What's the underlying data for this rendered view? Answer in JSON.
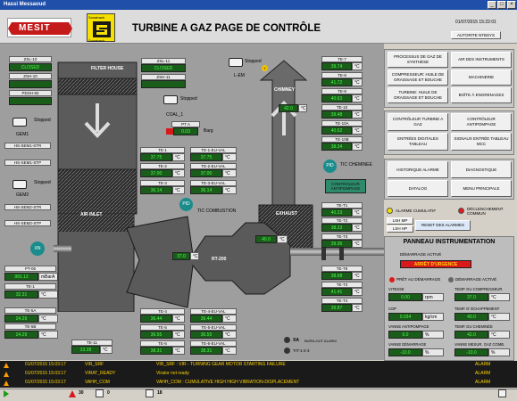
{
  "window": {
    "title": "Hassi Messaoud"
  },
  "header": {
    "logo": "MESIT",
    "brand_top": "Sonatrach",
    "brand_bottom": "Sonatrach",
    "title": "TURBINE A GAZ PAGE DE CONTRÔLE",
    "datetime": "01/07/2015 15:22:01",
    "authority": "AUTORITE NTBSYS"
  },
  "left": [
    {
      "label": "ZSL-10",
      "value": "CLOSED"
    },
    {
      "label": "ZSH-10",
      "value": ""
    },
    {
      "label": "PDSH-82",
      "value": ""
    }
  ],
  "motors_left": [
    {
      "label": "Stopped",
      "name": "GEM1"
    },
    {
      "label": "Stopped",
      "name": "GEM2"
    }
  ],
  "hs_labels": [
    "HS-SEM1-STR",
    "HS-SEM1-STP",
    "HS-SEM2-STR",
    "HS-SEM2-STP"
  ],
  "xn": "XN",
  "pt05": {
    "label": "PT-05",
    "value": "991.12",
    "unit": "mBarA"
  },
  "te1": {
    "label": "TE-1",
    "value": "32.31",
    "unit": "°C"
  },
  "te5a": {
    "label": "TE-5A",
    "value": "24.29",
    "unit": "°C"
  },
  "te5b": {
    "label": "TE-5B",
    "value": "24.29",
    "unit": "°C"
  },
  "filter_house": "FILTER HOUSE",
  "air_inlet": "AIR INLET",
  "zsl11": {
    "label": "ZSL-11",
    "value": "CLOSED"
  },
  "zsh11": {
    "label": "ZSH-11",
    "value": ""
  },
  "coal": {
    "state": "Stopped",
    "name": "COAL_1"
  },
  "lem": {
    "state": "Stopped",
    "name": "L-EM"
  },
  "pt_a": {
    "label": "PT A",
    "value": "0.03",
    "unit": "Barg"
  },
  "te_block1": [
    {
      "label": "TE-1",
      "value": "37.75",
      "unit": "°C"
    },
    {
      "label": "TE-2",
      "value": "37.00",
      "unit": "°C"
    },
    {
      "label": "TE-3",
      "value": "36.14",
      "unit": "°C"
    }
  ],
  "te_block1_val": [
    {
      "label": "TE-1-EU-VAL",
      "value": "37.75",
      "unit": "°C"
    },
    {
      "label": "TE-2-EU-VAL",
      "value": "37.00",
      "unit": "°C"
    },
    {
      "label": "TE-3-EU-VAL",
      "value": "36.14",
      "unit": "°C"
    }
  ],
  "combustion": {
    "pid": "PID",
    "label": "TIC COMBUSTION"
  },
  "rt200": "RT-200",
  "inner_val1": {
    "value": "37.0",
    "unit": "°C"
  },
  "inner_val2": {
    "value": "40.0",
    "unit": "°C"
  },
  "chimney": "CHIMNEY",
  "chimney_val": {
    "value": "42.0",
    "unit": "°C"
  },
  "exhaust": "EXHAUST",
  "te_block2": [
    {
      "label": "TE-4",
      "value": "36.44",
      "unit": "°C"
    },
    {
      "label": "TE-5",
      "value": "36.55",
      "unit": "°C"
    },
    {
      "label": "TE-6",
      "value": "38.31",
      "unit": "°C"
    }
  ],
  "te_block2_val": [
    {
      "label": "TE-4-EU-VAL",
      "value": "36.44",
      "unit": "°C"
    },
    {
      "label": "TE-5-EU-VAL",
      "value": "36.55",
      "unit": "°C"
    },
    {
      "label": "TE-6-EU-VAL",
      "value": "38.31",
      "unit": "°C"
    }
  ],
  "te11": {
    "label": "TE-11",
    "value": "23.28",
    "unit": "°C"
  },
  "chimney_tes": [
    {
      "label": "TE-7",
      "value": "39.74",
      "unit": "°C"
    },
    {
      "label": "TE-8",
      "value": "41.72",
      "unit": "°C"
    },
    {
      "label": "TE-9",
      "value": "40.63",
      "unit": "°C"
    },
    {
      "label": "TE-10",
      "value": "39.48",
      "unit": "°C"
    },
    {
      "label": "TE-10A",
      "value": "40.62",
      "unit": "°C"
    },
    {
      "label": "TE-10B",
      "value": "38.34",
      "unit": "°C"
    }
  ],
  "tic_cheminee": {
    "pid": "PID",
    "label": "TIC CHEMINEE"
  },
  "controleur": "CONTROLEUR ANTIPOMPAGE",
  "exhaust_tes": [
    {
      "label": "TE-T1",
      "value": "40.23",
      "unit": "°C"
    },
    {
      "label": "TE-T2",
      "value": "38.23",
      "unit": "°C"
    },
    {
      "label": "TE-T3",
      "value": "39.36",
      "unit": "°C"
    },
    {
      "label": "TE-T9",
      "value": "38.68",
      "unit": "°C"
    },
    {
      "label": "TE-T3",
      "value": "41.41",
      "unit": "°C"
    },
    {
      "label": "TE-T4",
      "value": "39.87",
      "unit": "°C"
    }
  ],
  "xa": {
    "label": "XA",
    "text": "BURN-OUT ALARM"
  },
  "tit": {
    "label": "TIT-1-2-3"
  },
  "nav": [
    [
      "PROCESSUS DE GAZ DE SYNTHÈSE",
      "AIR DES INSTRUMENTS"
    ],
    [
      "COMPRESSEUR: HUILE DE GRAISSAGE ET BOUCHE",
      "MACHINERIE"
    ],
    [
      "TURBINE: HUILE DE GRAISSAGE ET BOUCHE",
      "BOÎTE À ENGRENAGES"
    ]
  ],
  "nav2": [
    [
      "CONTRÔLEUR TURBINE A GAZ",
      "CONTRÔLEUR ANTIPOMPAGE"
    ],
    [
      "ENTRÉES DIGITALES TABLEAU",
      "SIGNAUX ENTRÉE TABLEAU MCC"
    ]
  ],
  "nav3": [
    [
      "HISTORIQUE ALARME",
      "DIAGNOSTIQUE"
    ],
    [
      "DATALOG",
      "MENU PRINCIPALE"
    ]
  ],
  "alarm_cumul": "ALARME CUMULATIF",
  "declenchement": "DÉCLENCHEMENT COMMUN",
  "lsh_mp": "LSH MP",
  "lsh_hp": "LSH HP",
  "reset": "RESET DES ALARMES",
  "instr": {
    "title": "PANNEAU INSTRUMENTATION",
    "demarrage_active": "DÉMARRAGE ACTIVÉ",
    "arret": "ARRÊT D'URGENCE",
    "pret": "PRÊT AU DÉMARRAGE",
    "demarrage_actif": "DÉMARRAGE ACTIVÉ",
    "vitesse": {
      "label": "VITESSE",
      "value": "0.00",
      "unit": "rpm"
    },
    "temp_comp": {
      "label": "TEMP. DU COMPRESSEUR",
      "value": "37.0",
      "unit": "°C"
    },
    "cop": {
      "label": "COP",
      "value": "0.034",
      "unit": "kg/cm"
    },
    "temp_echap": {
      "label": "TEMP. D' ÉCHAPPEMENT",
      "value": "40.0",
      "unit": "°C"
    },
    "vanne_anti": {
      "label": "VANNE ANTIPOMPAGE",
      "value": "0.0",
      "unit": "%"
    },
    "temp_chem": {
      "label": "TEMP. DU CHEMINÉE",
      "value": "42.0",
      "unit": "°C"
    },
    "vanne_dem": {
      "label": "VANNE DÉMARRAGE",
      "value": "-10.0",
      "unit": "%"
    },
    "vanne_gaz": {
      "label": "VANNE MESUR. GAZ COMB.",
      "value": "-10.0",
      "unit": "%"
    }
  },
  "alarms": [
    {
      "time": "01/07/2015 15:03:17",
      "tag": "VIR_SRF",
      "msg": "VIR_SRF : VIR - TURNING GEAR MOTOR STARTING FAILURE",
      "type": "ALARM"
    },
    {
      "time": "01/07/2015 15:03:17",
      "tag": "VIRAT_READY",
      "msg": "Virator not ready",
      "type": "ALARM"
    },
    {
      "time": "01/07/2015 15:03:17",
      "tag": "VAHH_COM",
      "msg": "VAHH_COM : CUMULATIVE HIGH HIGH VIBRATION-DISPLACEMENT",
      "type": "ALARM"
    }
  ],
  "status": {
    "count1": "30",
    "count2": "0",
    "count3": "18"
  }
}
